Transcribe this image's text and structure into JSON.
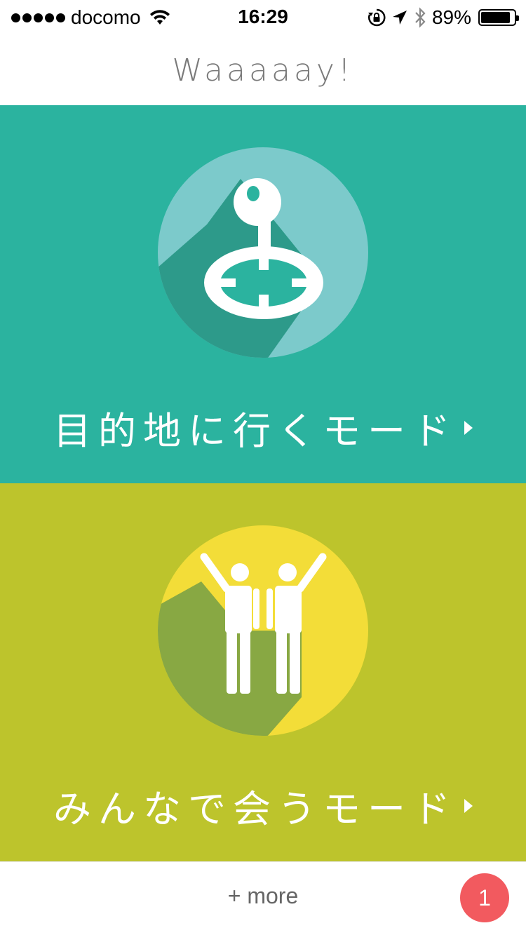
{
  "status_bar": {
    "carrier": "docomo",
    "signal_dots": 5,
    "time": "16:29",
    "battery": "89%",
    "battery_level": 0.89,
    "icons": [
      "wifi-icon",
      "rotation-lock-icon",
      "location-icon",
      "bluetooth-icon",
      "battery-icon"
    ]
  },
  "header": {
    "title": "Waaaaay!"
  },
  "modes": [
    {
      "label": "目的地に行くモード",
      "color": "#2bb39f",
      "circle": "#7ccacb",
      "icon": "joystick-icon"
    },
    {
      "label": "みんなで会うモード",
      "color": "#bdc42c",
      "circle": "#f3dd38",
      "icon": "two-people-icon"
    }
  ],
  "footer": {
    "more_label": "+ more",
    "badge_count": "1",
    "badge_color": "#f25a5f"
  }
}
